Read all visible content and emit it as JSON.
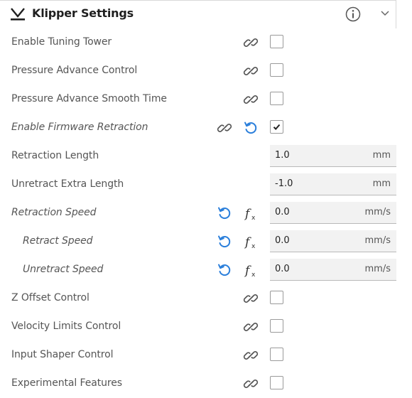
{
  "header": {
    "title": "Klipper Settings",
    "icon": "klipper-logo-icon",
    "info_icon": "info-icon",
    "collapse_icon": "chevron-down-icon"
  },
  "colors": {
    "accent_blue": "#2b7fdb",
    "text": "#555555",
    "title": "#1f1f1f"
  },
  "settings": [
    {
      "label": "Enable Tuning Tower",
      "control": "checkbox",
      "checked": false
    },
    {
      "label": "Pressure Advance Control",
      "control": "checkbox",
      "checked": false
    },
    {
      "label": "Pressure Advance Smooth Time",
      "control": "checkbox",
      "checked": false
    },
    {
      "label": "Enable Firmware Retraction",
      "control": "checkbox",
      "checked": true
    },
    {
      "label": "Retraction Length",
      "control": "field",
      "value": "1.0",
      "unit": "mm"
    },
    {
      "label": "Unretract Extra Length",
      "control": "field",
      "value": "-1.0",
      "unit": "mm"
    },
    {
      "label": "Retraction Speed",
      "control": "field",
      "value": "0.0",
      "unit": "mm/s"
    },
    {
      "label": "Retract Speed",
      "control": "field",
      "value": "0.0",
      "unit": "mm/s"
    },
    {
      "label": "Unretract Speed",
      "control": "field",
      "value": "0.0",
      "unit": "mm/s"
    },
    {
      "label": "Z Offset Control",
      "control": "checkbox",
      "checked": false
    },
    {
      "label": "Velocity Limits Control",
      "control": "checkbox",
      "checked": false
    },
    {
      "label": "Input Shaper Control",
      "control": "checkbox",
      "checked": false
    },
    {
      "label": "Experimental Features",
      "control": "checkbox",
      "checked": false
    }
  ]
}
